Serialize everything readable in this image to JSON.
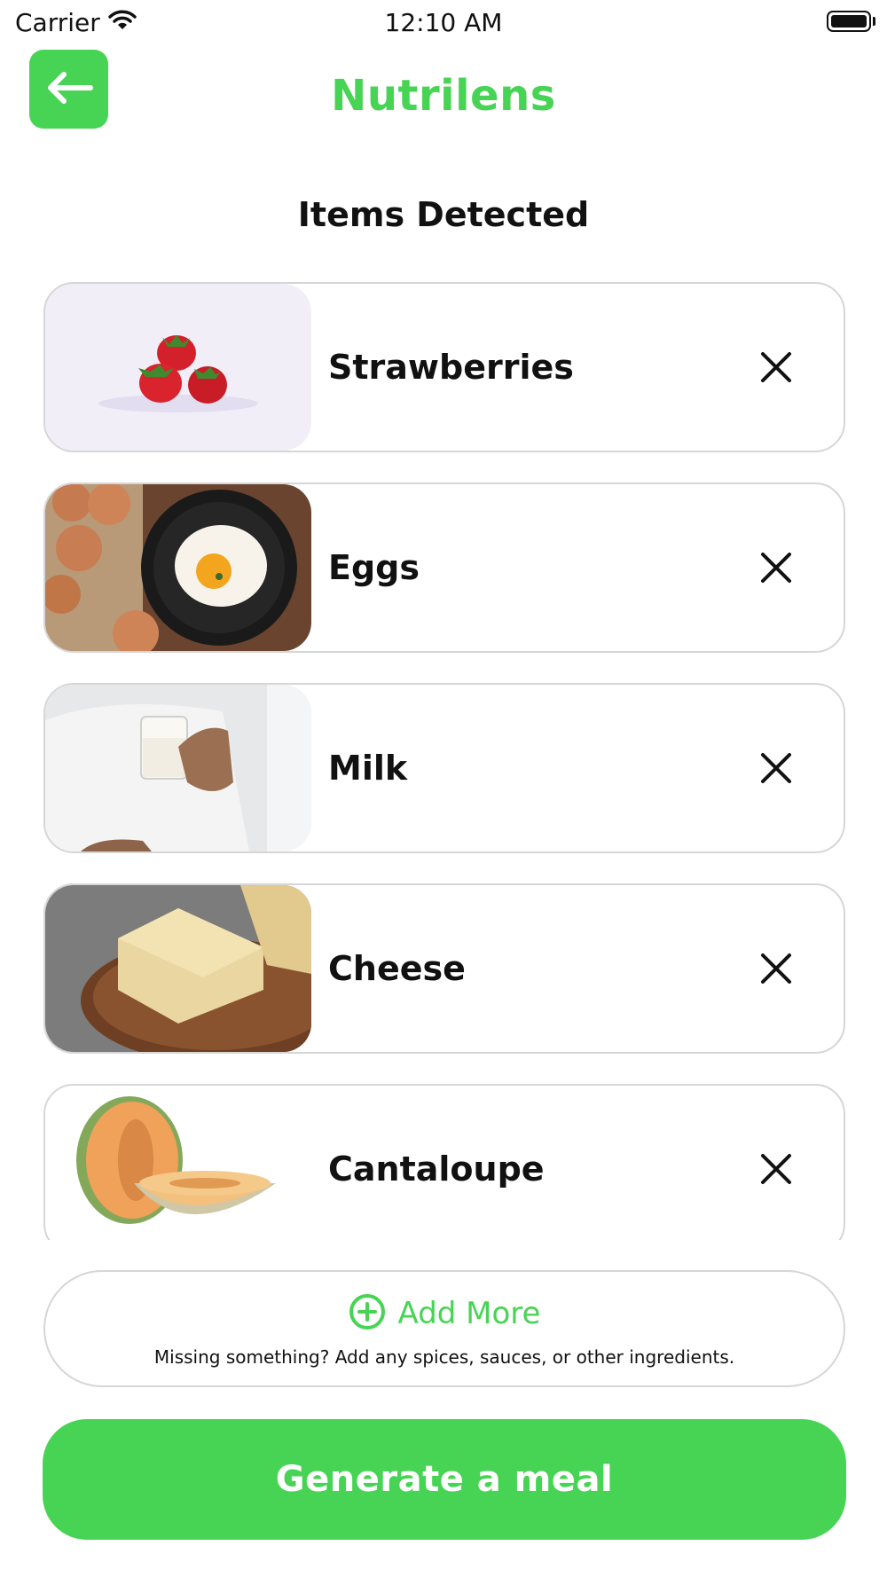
{
  "status_bar": {
    "carrier": "Carrier",
    "time": "12:10 AM",
    "icons": [
      "wifi-icon",
      "battery-icon"
    ]
  },
  "header": {
    "back_icon": "arrow-left-icon",
    "title": "Nutrilens"
  },
  "section_title": "Items Detected",
  "items": [
    {
      "label": "Strawberries",
      "image": "strawberries-image",
      "remove_icon": "close-icon"
    },
    {
      "label": "Eggs",
      "image": "eggs-image",
      "remove_icon": "close-icon"
    },
    {
      "label": "Milk",
      "image": "milk-image",
      "remove_icon": "close-icon"
    },
    {
      "label": "Cheese",
      "image": "cheese-image",
      "remove_icon": "close-icon"
    },
    {
      "label": "Cantaloupe",
      "image": "cantaloupe-image",
      "remove_icon": "close-icon"
    }
  ],
  "add_more": {
    "icon": "plus-circle-icon",
    "label": "Add More",
    "hint": "Missing something? Add any spices, sauces, or other ingredients."
  },
  "generate_button": {
    "label": "Generate a meal"
  },
  "colors": {
    "accent": "#47d454",
    "card_border": "#d6d6d6",
    "text": "#111111"
  }
}
